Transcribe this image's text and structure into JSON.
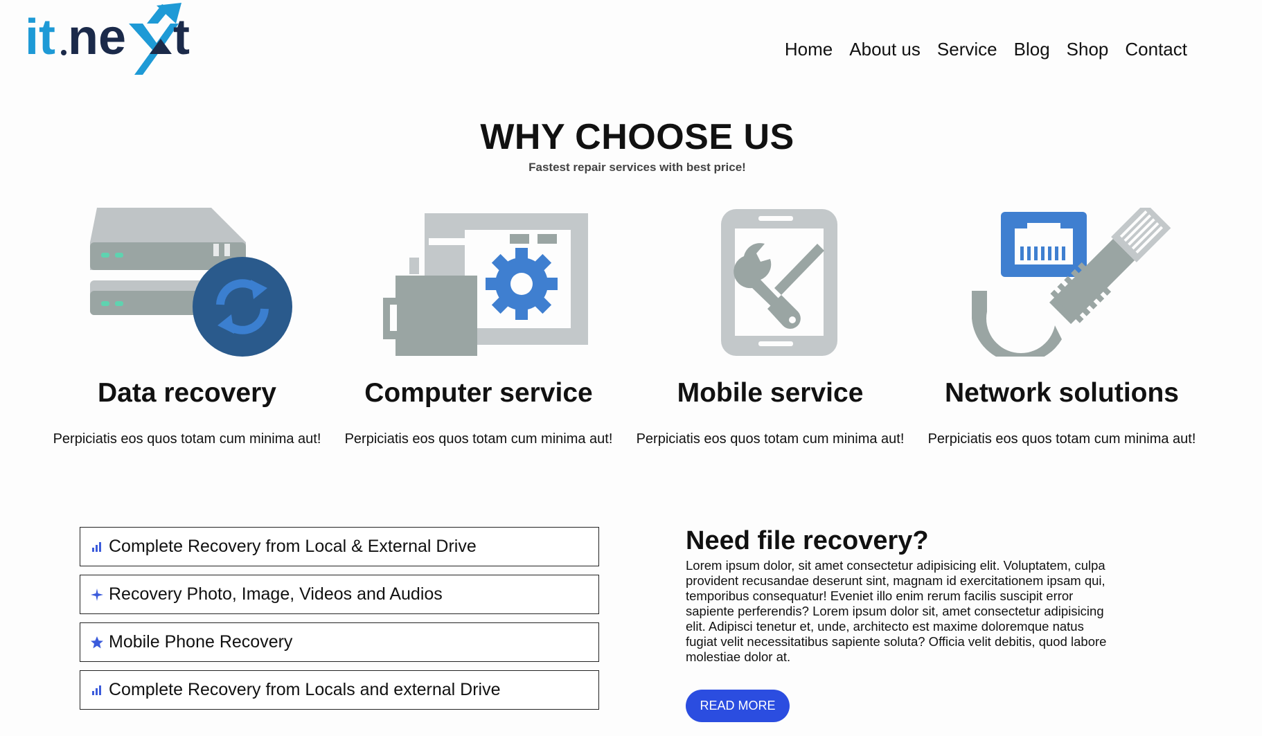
{
  "logo": {
    "text": "it.next",
    "primary_color": "#1b2a4a",
    "accent_color": "#1e9ad6"
  },
  "nav": {
    "items": [
      "Home",
      "About us",
      "Service",
      "Blog",
      "Shop",
      "Contact"
    ]
  },
  "why": {
    "title": "WHY CHOOSE US",
    "subtitle": "Fastest repair services with best price!"
  },
  "features": [
    {
      "icon": "server-sync-icon",
      "title": "Data recovery",
      "text": "Perpiciatis eos quos totam cum minima aut!"
    },
    {
      "icon": "computer-gear-icon",
      "title": "Computer service",
      "text": "Perpiciatis eos quos totam cum minima aut!"
    },
    {
      "icon": "mobile-tools-icon",
      "title": "Mobile service",
      "text": "Perpiciatis eos quos totam cum minima aut!"
    },
    {
      "icon": "network-cable-icon",
      "title": "Network solutions",
      "text": "Perpiciatis eos quos totam cum minima aut!"
    }
  ],
  "options": [
    {
      "icon": "bar-chart-icon",
      "label": "Complete Recovery from Local & External Drive"
    },
    {
      "icon": "plane-icon",
      "label": "Recovery Photo, Image, Videos and Audios"
    },
    {
      "icon": "star-icon",
      "label": "Mobile Phone Recovery"
    },
    {
      "icon": "bar-chart-icon",
      "label": "Complete Recovery from Locals and external Drive"
    }
  ],
  "need": {
    "title": "Need file recovery?",
    "text": "Lorem ipsum dolor, sit amet consectetur adipisicing elit. Voluptatem, culpa provident recusandae deserunt sint, magnam id exercitationem ipsam qui, temporibus consequatur! Eveniet illo enim rerum facilis suscipit error sapiente perferendis? Lorem ipsum dolor sit, amet consectetur adipisicing elit. Adipisci tenetur et, unde, architecto est maxime doloremque natus fugiat velit necessitatibus sapiente soluta? Officia velit debitis, quod labore molestiae dolor at.",
    "button": "READ MORE"
  },
  "colors": {
    "button_blue": "#2b4de0",
    "icon_blue": "#3b5bdb",
    "icon_gray": "#9aa3a6",
    "icon_dark_blue": "#2a5a8c"
  }
}
